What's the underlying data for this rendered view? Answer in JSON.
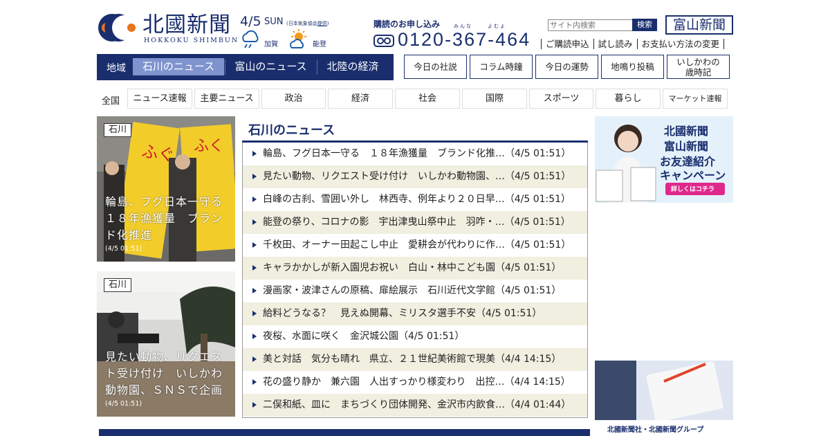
{
  "header": {
    "logo_jp": "北國新聞",
    "logo_en": "HOKKOKU SHIMBUN",
    "date": "4/5",
    "day": "SUN",
    "weather_credit_prefix": "(日本気象協会",
    "weather_credit_link": "提供",
    "weather_credit_suffix": ")",
    "weather": [
      {
        "area": "加賀",
        "icon": "cloud-rain-icon"
      },
      {
        "area": "能登",
        "icon": "sun-cloud-icon"
      }
    ],
    "subscribe_title": "購読のお申し込み",
    "ruby_minna": "みんな",
    "ruby_yomu": "よむよ",
    "phone": "0120-367-464",
    "search_placeholder": "サイト内検索",
    "search_button": "検索",
    "toyama_logo": "富山新聞",
    "sub_links": [
      "ご購読申込",
      "試し読み",
      "お支払い方法の変更"
    ]
  },
  "region_nav": {
    "label": "地域",
    "tabs": [
      {
        "label": "石川のニュース",
        "active": true
      },
      {
        "label": "富山のニュース",
        "active": false
      },
      {
        "label": "北陸の経済",
        "active": false
      }
    ]
  },
  "feature_links": [
    "今日の社説",
    "コラム時鐘",
    "今日の運勢",
    "地鳴り投稿",
    "いしかわの\n歳時記"
  ],
  "categories": {
    "all": "全国",
    "items": [
      "ニュース速報",
      "主要ニュース",
      "政治",
      "経済",
      "社会",
      "国際",
      "スポーツ",
      "暮らし",
      "マーケット速報"
    ]
  },
  "photo_stories": [
    {
      "tag": "石川",
      "caption": "輪島、フグ日本一守る　１８年漁獲量　ブランド化推進",
      "time": "(4/5 01:51)"
    },
    {
      "tag": "石川",
      "caption": "見たい動物、リクエスト受け付け　いしかわ動物園、ＳＮＳで企画",
      "time": "(4/5 01:51)"
    }
  ],
  "news": {
    "title": "石川のニュース",
    "items": [
      "輪島、フグ日本一守る　１８年漁獲量　ブランド化推…（4/5 01:51）",
      "見たい動物、リクエスト受け付け　いしかわ動物園、…（4/5 01:51）",
      "白峰の古刹、雪囲い外し　林西寺、例年より２０日早…（4/5 01:51）",
      "能登の祭り、コロナの影　宇出津曳山祭中止　羽咋・…（4/5 01:51）",
      "千枚田、オーナー田起こし中止　愛耕会が代わりに作…（4/5 01:51）",
      "キャラかかしが新入園児お祝い　白山・林中こども園（4/5 01:51）",
      "漫画家・波津さんの原稿、扉絵展示　石川近代文学館（4/5 01:51）",
      "給料どうなる？　見えぬ開幕、ミリスタ選手不安（4/5 01:51）",
      "夜桜、水面に咲く　金沢城公園（4/5 01:51）",
      "美と対話　気分も晴れ　県立、２１世紀美術館で現美（4/4 14:15）",
      "花の盛り静か　兼六園　人出すっかり様変わり　出控…（4/4 14:15）",
      "二俣和紙、皿に　まちづくり団体開発、金沢市内飲食…（4/4 01:44）"
    ]
  },
  "ads": {
    "ad1_title1": "北國新聞",
    "ad1_title2": "富山新聞",
    "ad1_line1": "お友達紹介",
    "ad1_line2": "キャンペーン",
    "ad1_button": "詳しくはコチラ",
    "ad2_caption": "北國新聞社・北國新聞グループ"
  },
  "colors": {
    "brand": "#1a2e6e",
    "active_tab": "#7f94cf",
    "alt_row": "#f0efe0"
  }
}
